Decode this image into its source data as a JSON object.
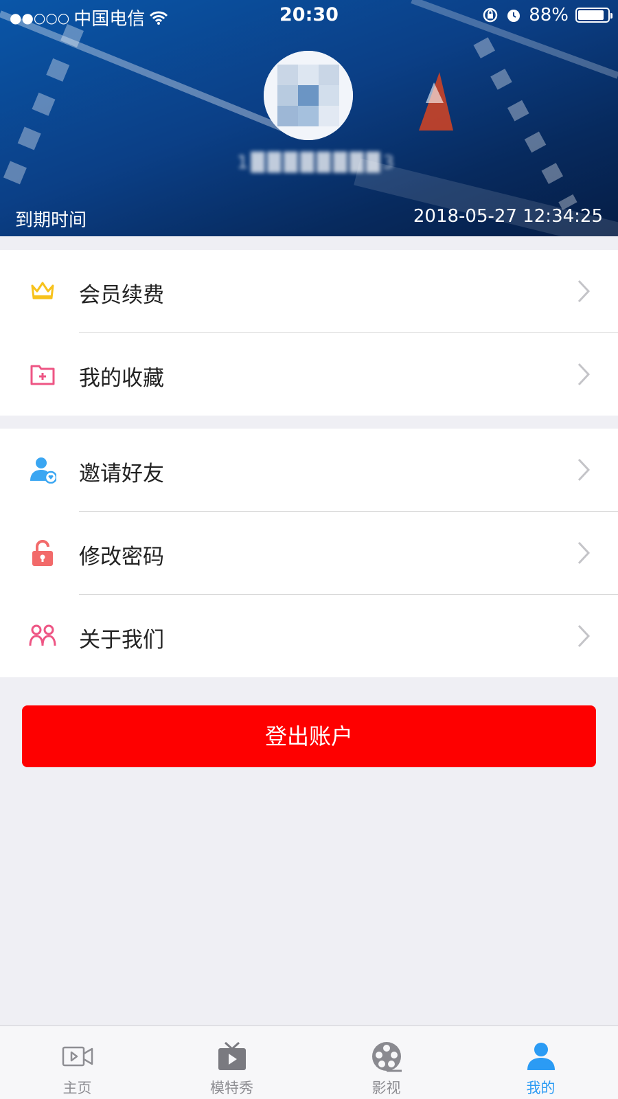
{
  "status_bar": {
    "signal": "●●○○○",
    "carrier": "中国电信",
    "time": "20:30",
    "battery": "88%",
    "battery_level": 0.88
  },
  "profile": {
    "phone_masked": "1████████3",
    "expire_label": "到期时间",
    "expire_value": "2018-05-27 12:34:25"
  },
  "menu": {
    "group1": [
      {
        "label": "会员续费",
        "icon": "crown-icon",
        "color": "#f7c21c"
      },
      {
        "label": "我的收藏",
        "icon": "folder-plus-icon",
        "color": "#ee5584"
      }
    ],
    "group2": [
      {
        "label": "邀请好友",
        "icon": "user-heart-icon",
        "color": "#3aa6f2"
      },
      {
        "label": "修改密码",
        "icon": "unlock-icon",
        "color": "#f26a6a"
      },
      {
        "label": "关于我们",
        "icon": "people-icon",
        "color": "#ee5584"
      }
    ]
  },
  "logout_label": "登出账户",
  "tabbar": {
    "tabs": [
      {
        "label": "主页",
        "icon": "video-camera-icon",
        "active": false
      },
      {
        "label": "模特秀",
        "icon": "tv-icon",
        "active": false
      },
      {
        "label": "影视",
        "icon": "film-reel-icon",
        "active": false
      },
      {
        "label": "我的",
        "icon": "person-icon",
        "active": true
      }
    ]
  },
  "colors": {
    "accent": "#2b9bf4",
    "logout": "#fe0000",
    "header": "#0b3f86"
  }
}
